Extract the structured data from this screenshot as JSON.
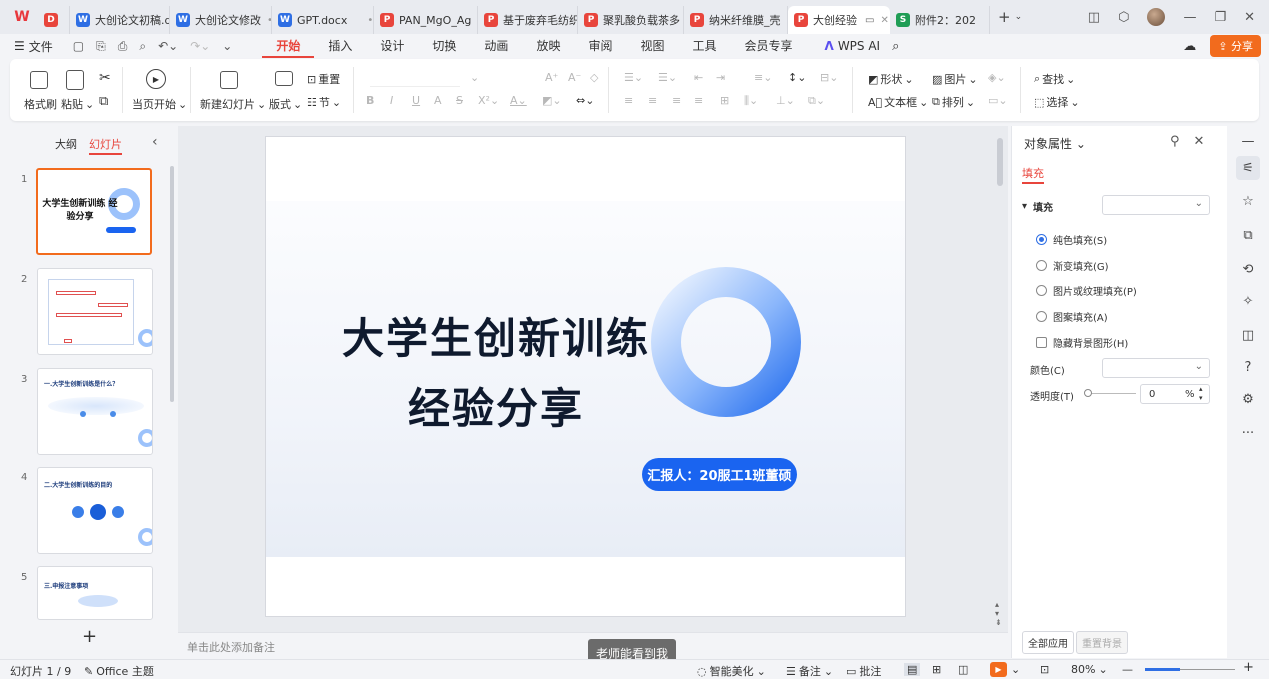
{
  "tabs": [
    {
      "label": "大创论文初稿.d",
      "type": "w",
      "dot": "•"
    },
    {
      "label": "大创论文修改",
      "type": "w",
      "dot": "•"
    },
    {
      "label": "GPT.docx",
      "type": "w",
      "dot": "•"
    },
    {
      "label": "PAN_MgO_Ag",
      "type": "p",
      "dot": ""
    },
    {
      "label": "基于废弃毛纺织",
      "type": "p",
      "dot": ""
    },
    {
      "label": "聚乳酸负载茶多",
      "type": "p",
      "dot": ""
    },
    {
      "label": "纳米纤维膜_壳",
      "type": "p",
      "dot": ""
    },
    {
      "label": "大创经验",
      "type": "p",
      "dot": "✕",
      "active": true
    },
    {
      "label": "附件2：202",
      "type": "s",
      "dot": ""
    }
  ],
  "menubar": {
    "file": "文件",
    "tabs": [
      "开始",
      "插入",
      "设计",
      "切换",
      "动画",
      "放映",
      "审阅",
      "视图",
      "工具",
      "会员专享"
    ],
    "active_tab": "开始",
    "wps_ai": "WPS AI",
    "share": "分享"
  },
  "ribbon": {
    "format_painter": "格式刷",
    "paste": "粘贴",
    "from_current": "当页开始",
    "new_slide": "新建幻灯片",
    "layout": "版式",
    "reset": "重置",
    "section": "节",
    "shape": "形状",
    "picture": "图片",
    "find": "查找",
    "textbox": "文本框",
    "arrange": "排列",
    "select": "选择"
  },
  "left_panel": {
    "tab_outline": "大纲",
    "tab_slides": "幻灯片",
    "slides": [
      {
        "num": "1",
        "title": "大学生创新训练 经验分享"
      },
      {
        "num": "2",
        "title": ""
      },
      {
        "num": "3",
        "title": "一.大学生创新训练是什么？"
      },
      {
        "num": "4",
        "title": "二.大学生创新训练的目的"
      },
      {
        "num": "5",
        "title": "三.申报注意事项"
      }
    ],
    "add_slide": "+"
  },
  "slide": {
    "title_line1": "大学生创新训练",
    "title_line2": "经验分享",
    "presenter": "汇报人：20服工1班董硕"
  },
  "notes": {
    "placeholder": "单击此处添加备注",
    "toast": "老师能看到我"
  },
  "properties": {
    "title": "对象属性",
    "fill_tab": "填充",
    "fill_label": "填充",
    "options": [
      {
        "label": "纯色填充(S)",
        "checked": true
      },
      {
        "label": "渐变填充(G)",
        "checked": false
      },
      {
        "label": "图片或纹理填充(P)",
        "checked": false
      },
      {
        "label": "图案填充(A)",
        "checked": false
      }
    ],
    "hide_bg": "隐藏背景图形(H)",
    "color_label": "颜色(C)",
    "transparency_label": "透明度(T)",
    "transparency_value": "0",
    "transparency_unit": "%",
    "apply_all": "全部应用",
    "reset_bg": "重置背景"
  },
  "statusbar": {
    "slide_count": "幻灯片 1 / 9",
    "theme": "Office 主题",
    "beautify": "智能美化",
    "notes": "备注",
    "comments": "批注",
    "zoom": "80%",
    "zoom_level": 0.39
  },
  "colors": {
    "accent": "#e8453c",
    "orange": "#f26b1d",
    "presenter_bg": "#1a64f0"
  }
}
